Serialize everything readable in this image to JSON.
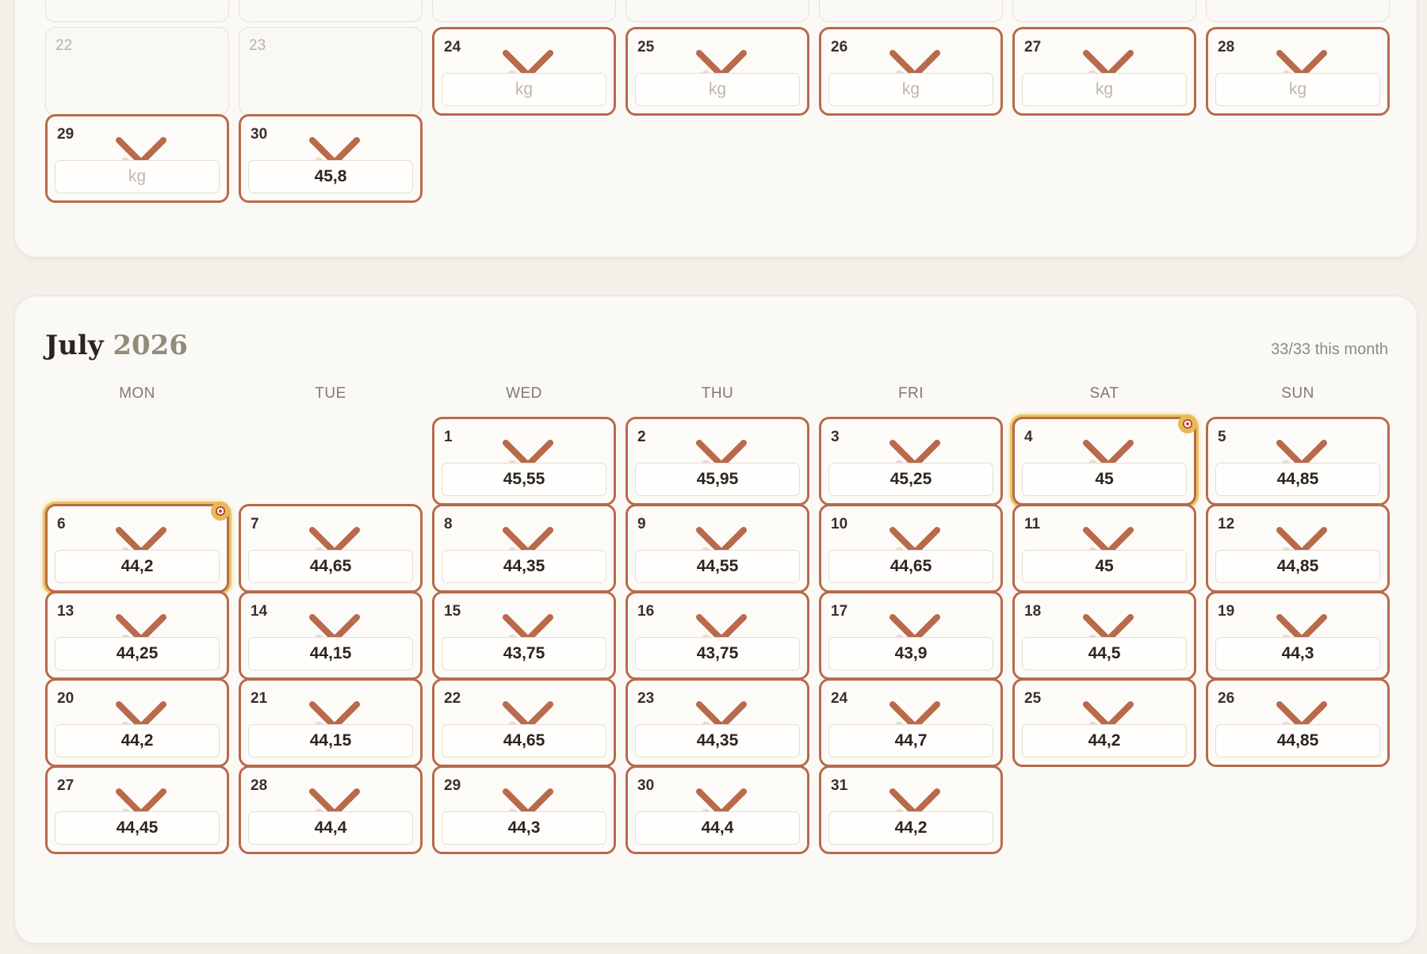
{
  "previous_month": {
    "weight_placeholder": "kg",
    "days": [
      {
        "day": "",
        "state": "empty"
      },
      {
        "day": "",
        "state": "empty"
      },
      {
        "day": "",
        "state": "empty"
      },
      {
        "day": "",
        "state": "empty"
      },
      {
        "day": "",
        "state": "empty"
      },
      {
        "day": "",
        "state": "empty"
      },
      {
        "day": "",
        "state": "empty"
      },
      {
        "day": "22",
        "state": "inactive"
      },
      {
        "day": "23",
        "state": "inactive"
      },
      {
        "day": "24",
        "state": "active",
        "weight": ""
      },
      {
        "day": "25",
        "state": "active",
        "weight": ""
      },
      {
        "day": "26",
        "state": "active",
        "weight": ""
      },
      {
        "day": "27",
        "state": "active",
        "weight": ""
      },
      {
        "day": "28",
        "state": "active",
        "weight": ""
      },
      {
        "day": "29",
        "state": "active",
        "weight": ""
      },
      {
        "day": "30",
        "state": "active",
        "weight": "45,8"
      }
    ]
  },
  "july": {
    "month": "July",
    "year": "2026",
    "summary": "33/33 this month",
    "weekdays": [
      "MON",
      "TUE",
      "WED",
      "THU",
      "FRI",
      "SAT",
      "SUN"
    ],
    "leading_blanks": 2,
    "days": [
      {
        "day": "1",
        "weight": "45,55"
      },
      {
        "day": "2",
        "weight": "45,95"
      },
      {
        "day": "3",
        "weight": "45,25"
      },
      {
        "day": "4",
        "weight": "45",
        "goal": true
      },
      {
        "day": "5",
        "weight": "44,85"
      },
      {
        "day": "6",
        "weight": "44,2",
        "goal": true
      },
      {
        "day": "7",
        "weight": "44,65"
      },
      {
        "day": "8",
        "weight": "44,35"
      },
      {
        "day": "9",
        "weight": "44,55"
      },
      {
        "day": "10",
        "weight": "44,65"
      },
      {
        "day": "11",
        "weight": "45"
      },
      {
        "day": "12",
        "weight": "44,85"
      },
      {
        "day": "13",
        "weight": "44,25"
      },
      {
        "day": "14",
        "weight": "44,15"
      },
      {
        "day": "15",
        "weight": "43,75"
      },
      {
        "day": "16",
        "weight": "43,75"
      },
      {
        "day": "17",
        "weight": "43,9"
      },
      {
        "day": "18",
        "weight": "44,5"
      },
      {
        "day": "19",
        "weight": "44,3"
      },
      {
        "day": "20",
        "weight": "44,2"
      },
      {
        "day": "21",
        "weight": "44,15"
      },
      {
        "day": "22",
        "weight": "44,65"
      },
      {
        "day": "23",
        "weight": "44,35"
      },
      {
        "day": "24",
        "weight": "44,7"
      },
      {
        "day": "25",
        "weight": "44,2"
      },
      {
        "day": "26",
        "weight": "44,85"
      },
      {
        "day": "27",
        "weight": "44,45"
      },
      {
        "day": "28",
        "weight": "44,4"
      },
      {
        "day": "29",
        "weight": "44,3"
      },
      {
        "day": "30",
        "weight": "44,4"
      },
      {
        "day": "31",
        "weight": "44,2"
      }
    ]
  },
  "colors": {
    "accent": "#b86a4b",
    "goal_ring": "#e9c45e",
    "background": "#f3f0ea",
    "card": "#fbf9f5"
  },
  "icons": {
    "day_mark": "check-cross-icon",
    "goal_badge": "target-icon"
  }
}
